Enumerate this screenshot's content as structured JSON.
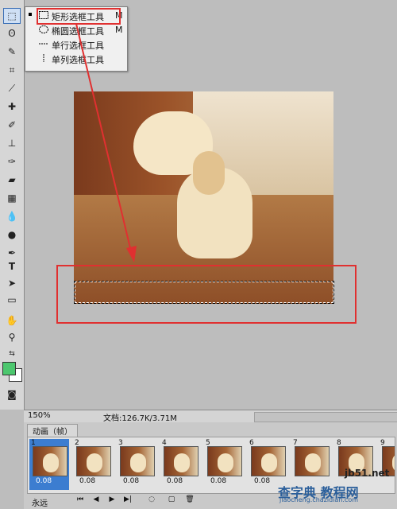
{
  "flyout": {
    "items": [
      {
        "label": "矩形选框工具",
        "key": "M",
        "icon": "rect-marquee-icon",
        "selected": true
      },
      {
        "label": "椭圆选框工具",
        "key": "M",
        "icon": "ellipse-marquee-icon",
        "selected": false
      },
      {
        "label": "单行选框工具",
        "key": "",
        "icon": "single-row-marquee-icon",
        "selected": false
      },
      {
        "label": "单列选框工具",
        "key": "",
        "icon": "single-column-marquee-icon",
        "selected": false
      }
    ]
  },
  "status": {
    "zoom": "150%",
    "doc": "文档:126.7K/3.71M"
  },
  "animation": {
    "tab_label": "动画（帧）",
    "loop": "永远",
    "frames": [
      {
        "num": "1",
        "delay": "0.08"
      },
      {
        "num": "2",
        "delay": "0.08"
      },
      {
        "num": "3",
        "delay": "0.08"
      },
      {
        "num": "4",
        "delay": "0.08"
      },
      {
        "num": "5",
        "delay": "0.08"
      },
      {
        "num": "6",
        "delay": "0.08"
      },
      {
        "num": "7",
        "delay": ""
      },
      {
        "num": "8",
        "delay": ""
      },
      {
        "num": "9",
        "delay": ""
      }
    ]
  },
  "watermark": {
    "top": "jb51.net",
    "main": "查字典 教程网",
    "sub": "jiaocheng.chazidian.com"
  },
  "colors": {
    "foreground": "#4cc76e",
    "background": "#ffffff",
    "annotation": "#e03030"
  }
}
